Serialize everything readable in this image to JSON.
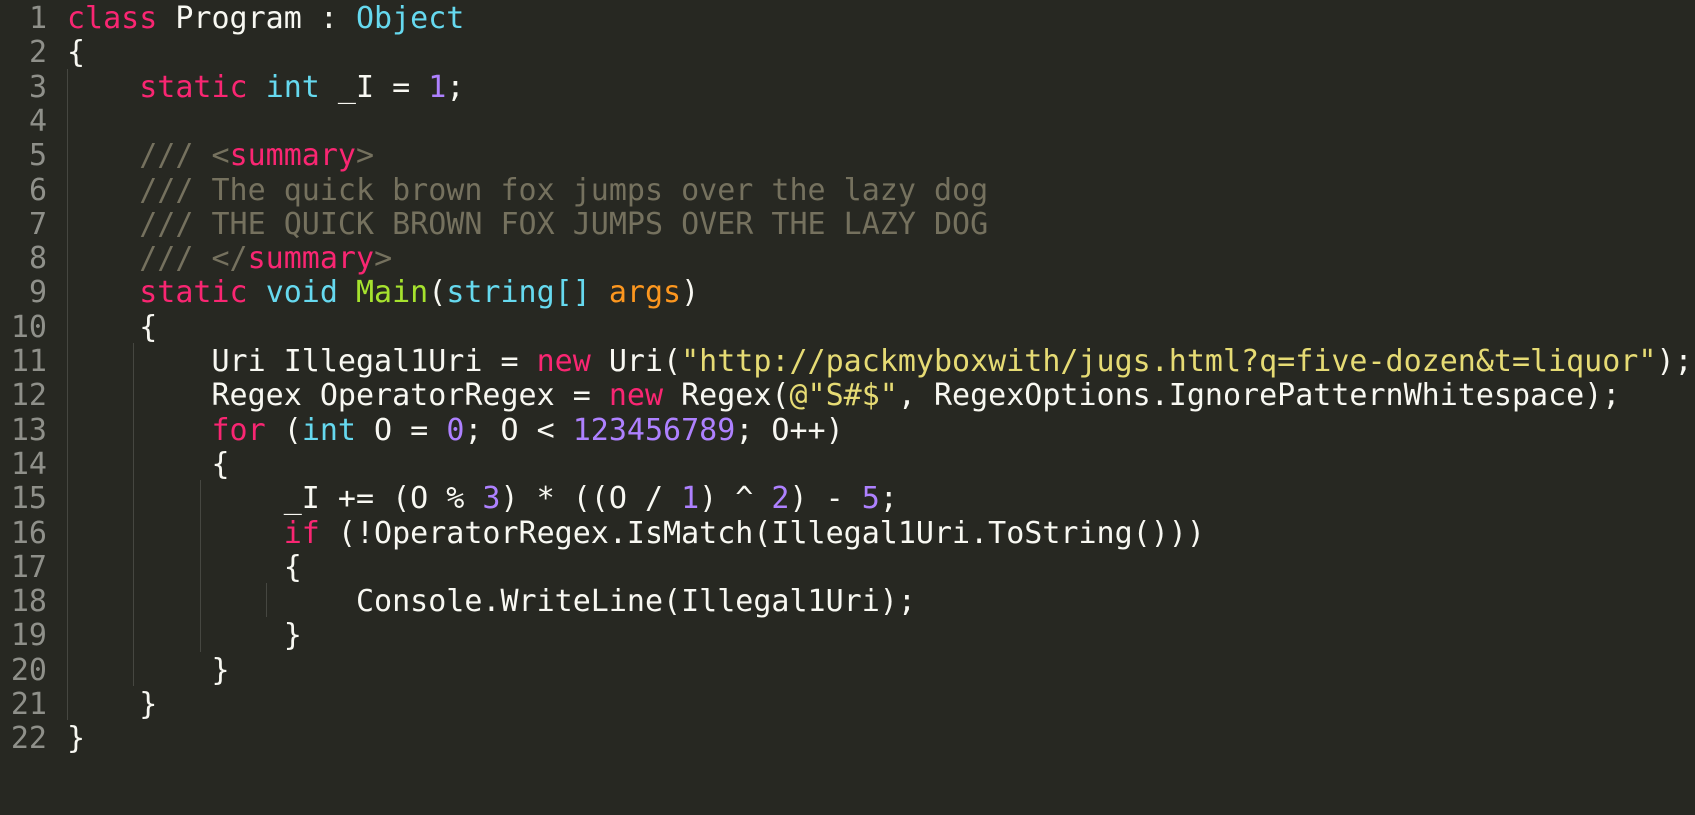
{
  "editor": {
    "language": "C#",
    "theme": "Monokai",
    "colors": {
      "background": "#272822",
      "gutter_text": "#8f908a",
      "keyword": "#f92672",
      "type": "#66d9ef",
      "number": "#ae81ff",
      "string": "#e6db74",
      "function": "#a6e22e",
      "parameter": "#fd971f",
      "comment": "#75715e",
      "plain": "#f8f8f2"
    },
    "lines": [
      {
        "number": "1",
        "tokens": [
          {
            "text": "class",
            "kind": "kw"
          },
          {
            "text": " Program : ",
            "kind": "plain"
          },
          {
            "text": "Object",
            "kind": "type"
          }
        ]
      },
      {
        "number": "2",
        "tokens": [
          {
            "text": "{",
            "kind": "plain"
          }
        ]
      },
      {
        "number": "3",
        "tokens": [
          {
            "text": "    ",
            "kind": "plain"
          },
          {
            "text": "static",
            "kind": "kw"
          },
          {
            "text": " ",
            "kind": "plain"
          },
          {
            "text": "int",
            "kind": "type"
          },
          {
            "text": " _I = ",
            "kind": "plain"
          },
          {
            "text": "1",
            "kind": "num"
          },
          {
            "text": ";",
            "kind": "plain"
          }
        ]
      },
      {
        "number": "4",
        "tokens": []
      },
      {
        "number": "5",
        "tokens": [
          {
            "text": "    /// <",
            "kind": "comment"
          },
          {
            "text": "summary",
            "kind": "kw"
          },
          {
            "text": ">",
            "kind": "comment"
          }
        ]
      },
      {
        "number": "6",
        "tokens": [
          {
            "text": "    /// The quick brown fox jumps over the lazy dog",
            "kind": "comment"
          }
        ]
      },
      {
        "number": "7",
        "tokens": [
          {
            "text": "    /// THE QUICK BROWN FOX JUMPS OVER THE LAZY DOG",
            "kind": "comment"
          }
        ]
      },
      {
        "number": "8",
        "tokens": [
          {
            "text": "    /// </",
            "kind": "comment"
          },
          {
            "text": "summary",
            "kind": "kw"
          },
          {
            "text": ">",
            "kind": "comment"
          }
        ]
      },
      {
        "number": "9",
        "tokens": [
          {
            "text": "    ",
            "kind": "plain"
          },
          {
            "text": "static",
            "kind": "kw"
          },
          {
            "text": " ",
            "kind": "plain"
          },
          {
            "text": "void",
            "kind": "type"
          },
          {
            "text": " ",
            "kind": "plain"
          },
          {
            "text": "Main",
            "kind": "fn"
          },
          {
            "text": "(",
            "kind": "plain"
          },
          {
            "text": "string[]",
            "kind": "type"
          },
          {
            "text": " ",
            "kind": "plain"
          },
          {
            "text": "args",
            "kind": "param"
          },
          {
            "text": ")",
            "kind": "plain"
          }
        ]
      },
      {
        "number": "10",
        "tokens": [
          {
            "text": "    {",
            "kind": "plain"
          }
        ]
      },
      {
        "number": "11",
        "tokens": [
          {
            "text": "        Uri Illegal1Uri = ",
            "kind": "plain"
          },
          {
            "text": "new",
            "kind": "kw"
          },
          {
            "text": " Uri(",
            "kind": "plain"
          },
          {
            "text": "\"http://packmyboxwith/jugs.html?q=five-dozen&t=liquor\"",
            "kind": "str"
          },
          {
            "text": ");",
            "kind": "plain"
          }
        ]
      },
      {
        "number": "12",
        "tokens": [
          {
            "text": "        Regex OperatorRegex = ",
            "kind": "plain"
          },
          {
            "text": "new",
            "kind": "kw"
          },
          {
            "text": " Regex(",
            "kind": "plain"
          },
          {
            "text": "@\"S#$\"",
            "kind": "str"
          },
          {
            "text": ", RegexOptions.IgnorePatternWhitespace);",
            "kind": "plain"
          }
        ]
      },
      {
        "number": "13",
        "tokens": [
          {
            "text": "        ",
            "kind": "plain"
          },
          {
            "text": "for",
            "kind": "kw"
          },
          {
            "text": " (",
            "kind": "plain"
          },
          {
            "text": "int",
            "kind": "type"
          },
          {
            "text": " O = ",
            "kind": "plain"
          },
          {
            "text": "0",
            "kind": "num"
          },
          {
            "text": "; O < ",
            "kind": "plain"
          },
          {
            "text": "123456789",
            "kind": "num"
          },
          {
            "text": "; O++)",
            "kind": "plain"
          }
        ]
      },
      {
        "number": "14",
        "tokens": [
          {
            "text": "        {",
            "kind": "plain"
          }
        ]
      },
      {
        "number": "15",
        "tokens": [
          {
            "text": "            _I += (O % ",
            "kind": "plain"
          },
          {
            "text": "3",
            "kind": "num"
          },
          {
            "text": ") * ((O / ",
            "kind": "plain"
          },
          {
            "text": "1",
            "kind": "num"
          },
          {
            "text": ") ^ ",
            "kind": "plain"
          },
          {
            "text": "2",
            "kind": "num"
          },
          {
            "text": ") - ",
            "kind": "plain"
          },
          {
            "text": "5",
            "kind": "num"
          },
          {
            "text": ";",
            "kind": "plain"
          }
        ]
      },
      {
        "number": "16",
        "tokens": [
          {
            "text": "            ",
            "kind": "plain"
          },
          {
            "text": "if",
            "kind": "kw"
          },
          {
            "text": " (!OperatorRegex.IsMatch(Illegal1Uri.ToString()))",
            "kind": "plain"
          }
        ]
      },
      {
        "number": "17",
        "tokens": [
          {
            "text": "            {",
            "kind": "plain"
          }
        ]
      },
      {
        "number": "18",
        "tokens": [
          {
            "text": "                Console.WriteLine(Illegal1Uri);",
            "kind": "plain"
          }
        ]
      },
      {
        "number": "19",
        "tokens": [
          {
            "text": "            }",
            "kind": "plain"
          }
        ]
      },
      {
        "number": "20",
        "tokens": [
          {
            "text": "        }",
            "kind": "plain"
          }
        ]
      },
      {
        "number": "21",
        "tokens": [
          {
            "text": "    }",
            "kind": "plain"
          }
        ]
      },
      {
        "number": "22",
        "tokens": [
          {
            "text": "}",
            "kind": "plain"
          }
        ]
      }
    ],
    "indent_guides": [
      {
        "level": 1,
        "from_line": 3,
        "to_line": 21
      },
      {
        "level": 2,
        "from_line": 11,
        "to_line": 20
      },
      {
        "level": 3,
        "from_line": 15,
        "to_line": 19
      },
      {
        "level": 4,
        "from_line": 18,
        "to_line": 18
      }
    ]
  }
}
